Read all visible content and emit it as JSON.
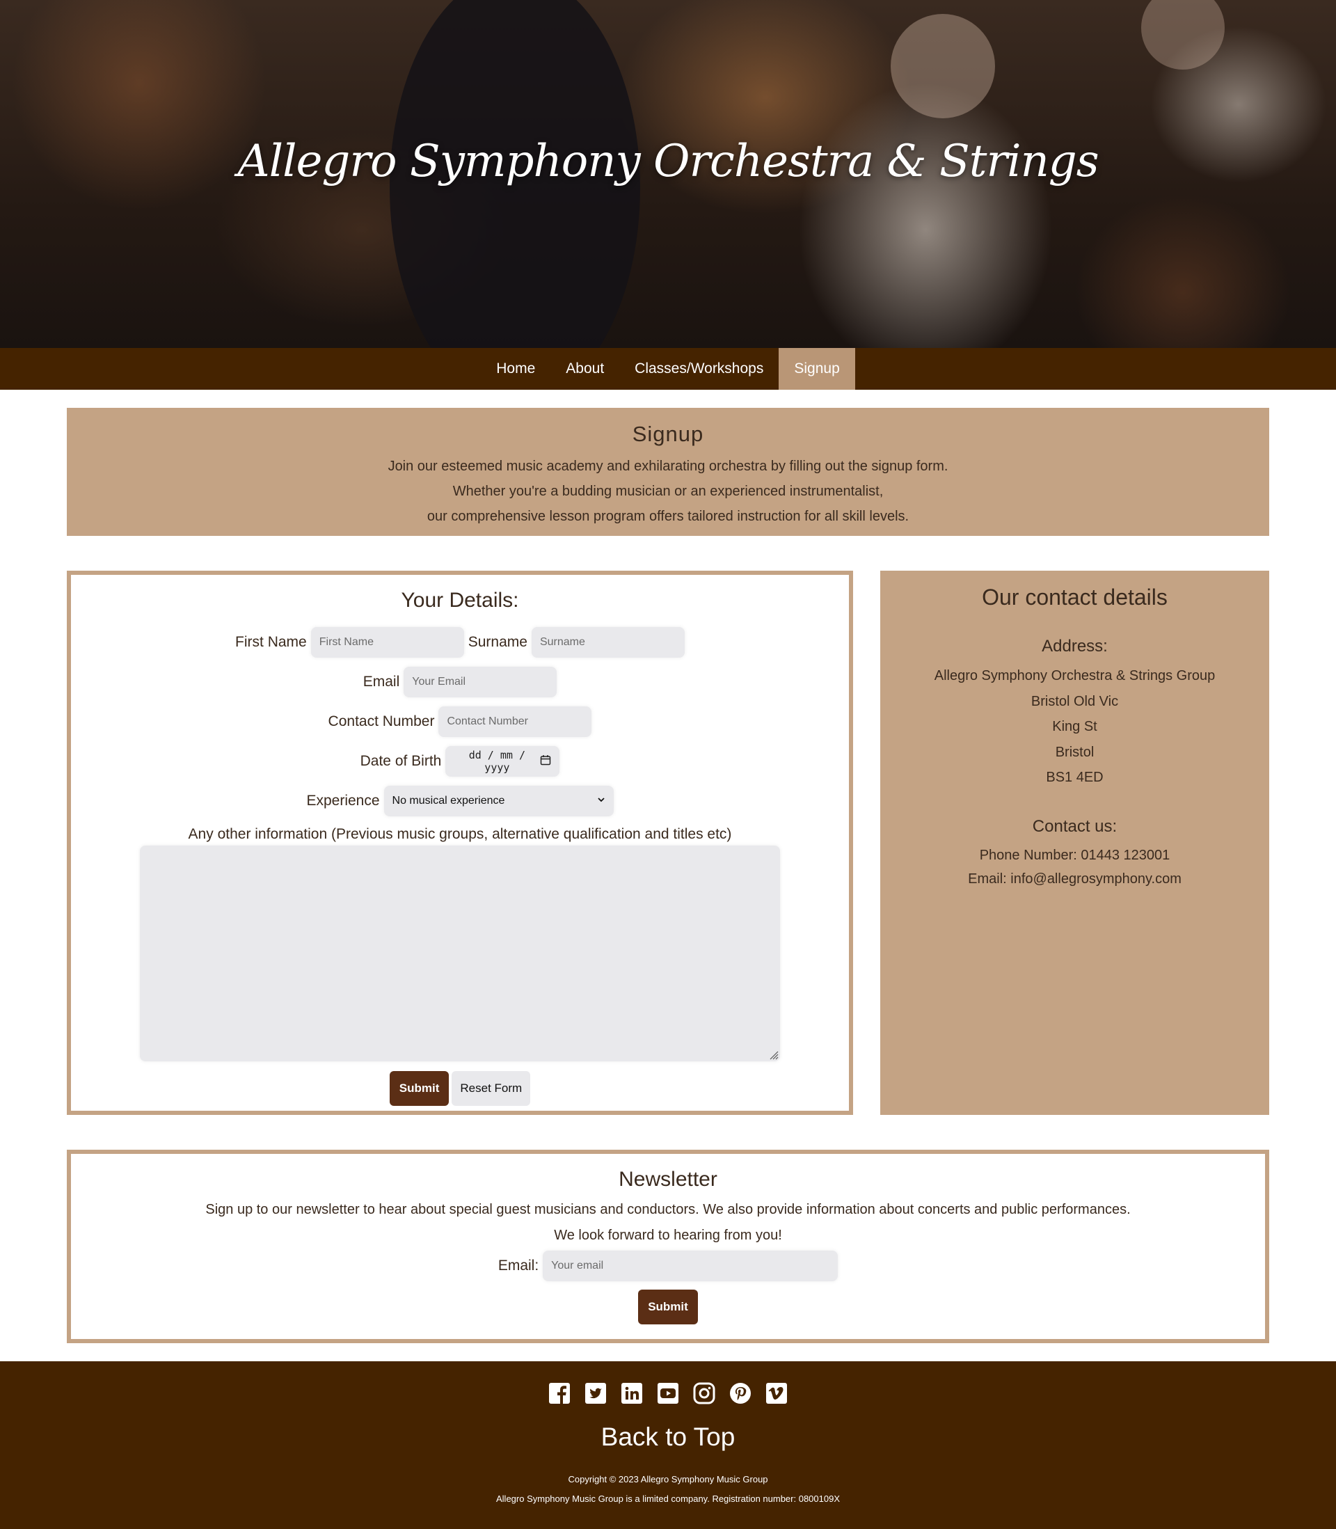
{
  "site": {
    "title": "Allegro Symphony Orchestra & Strings"
  },
  "nav": {
    "items": [
      {
        "label": "Home"
      },
      {
        "label": "About"
      },
      {
        "label": "Classes/Workshops"
      },
      {
        "label": "Signup"
      }
    ],
    "active": "Signup"
  },
  "intro": {
    "title": "Signup",
    "lines": [
      "Join our esteemed music academy and exhilarating orchestra by filling out the signup form.",
      "Whether you're a budding musician or an experienced instrumentalist,",
      "our comprehensive lesson program offers tailored instruction for all skill levels."
    ]
  },
  "form": {
    "title": "Your Details:",
    "first_name_label": "First Name",
    "first_name_placeholder": "First Name",
    "surname_label": "Surname",
    "surname_placeholder": "Surname",
    "email_label": "Email",
    "email_placeholder": "Your Email",
    "contact_label": "Contact Number",
    "contact_placeholder": "Contact Number",
    "dob_label": "Date of Birth",
    "dob_placeholder": "dd / mm / yyyy",
    "experience_label": "Experience",
    "experience_selected": "No musical experience",
    "other_label": "Any other information (Previous music groups, alternative qualification and titles etc)",
    "submit_label": "Submit",
    "reset_label": "Reset Form"
  },
  "contact": {
    "title": "Our contact details",
    "address_heading": "Address:",
    "address_lines": [
      "Allegro Symphony Orchestra & Strings Group",
      "Bristol Old Vic",
      "King St",
      "Bristol",
      "BS1 4ED"
    ],
    "contact_heading": "Contact us:",
    "phone": "Phone Number: 01443 123001",
    "email": "Email: info@allegrosymphony.com"
  },
  "newsletter": {
    "title": "Newsletter",
    "lines": [
      "Sign up to our newsletter to hear about special guest musicians and conductors. We also provide information about concerts and public performances.",
      "We look forward to hearing from you!"
    ],
    "email_label": "Email:",
    "email_placeholder": "Your email",
    "submit_label": "Submit"
  },
  "footer": {
    "socials": [
      "facebook-icon",
      "twitter-icon",
      "linkedin-icon",
      "youtube-icon",
      "instagram-icon",
      "pinterest-icon",
      "vimeo-icon"
    ],
    "back_to_top": "Back to Top",
    "copyright": "Copyright © 2023 Allegro Symphony Music Group",
    "registration": "Allegro Symphony Music Group is a limited company. Registration number: 0800109X"
  },
  "colors": {
    "nav_bg": "#452300",
    "nav_active": "#b99676",
    "panel": "#c4a384",
    "button": "#5b2e15"
  }
}
